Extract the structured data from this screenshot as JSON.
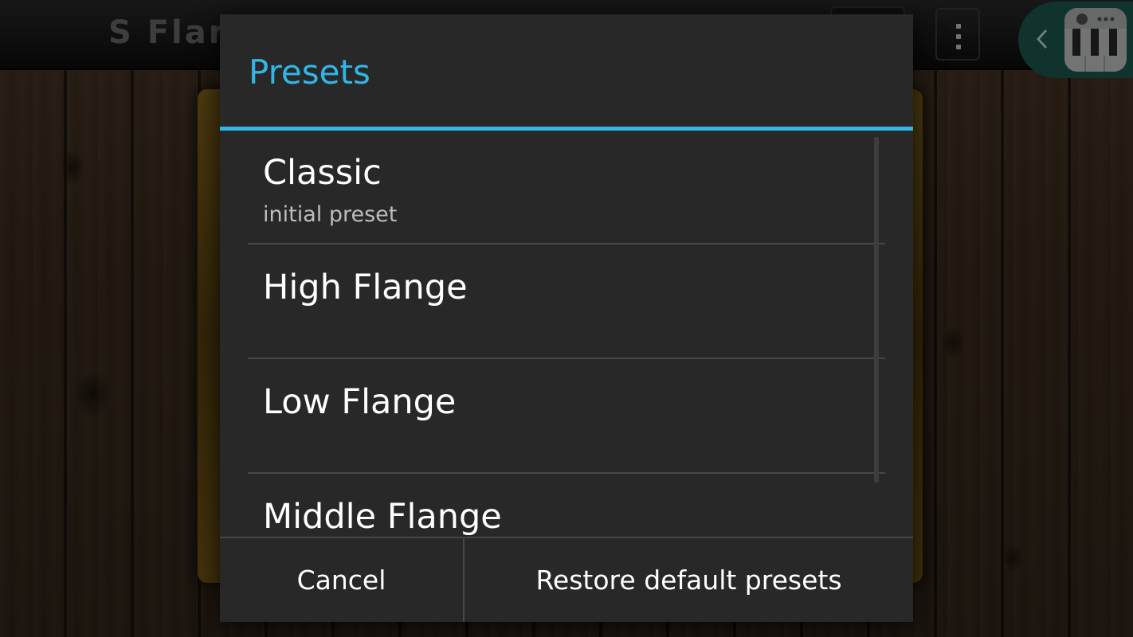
{
  "app": {
    "title": "S Flar"
  },
  "dialog": {
    "title": "Presets",
    "presets": [
      {
        "name": "Classic",
        "subtitle": "initial preset"
      },
      {
        "name": "High Flange",
        "subtitle": ""
      },
      {
        "name": "Low Flange",
        "subtitle": ""
      },
      {
        "name": "Middle Flange",
        "subtitle": ""
      }
    ],
    "buttons": {
      "cancel": "Cancel",
      "restore": "Restore default presets"
    }
  },
  "icons": {
    "overflow": "overflow-menu-icon",
    "back": "chevron-left-icon",
    "piano": "piano-app-icon"
  },
  "colors": {
    "accent": "#33b5e5",
    "dialog_bg": "#282828",
    "shortcut_bg": "#1f5e52"
  }
}
